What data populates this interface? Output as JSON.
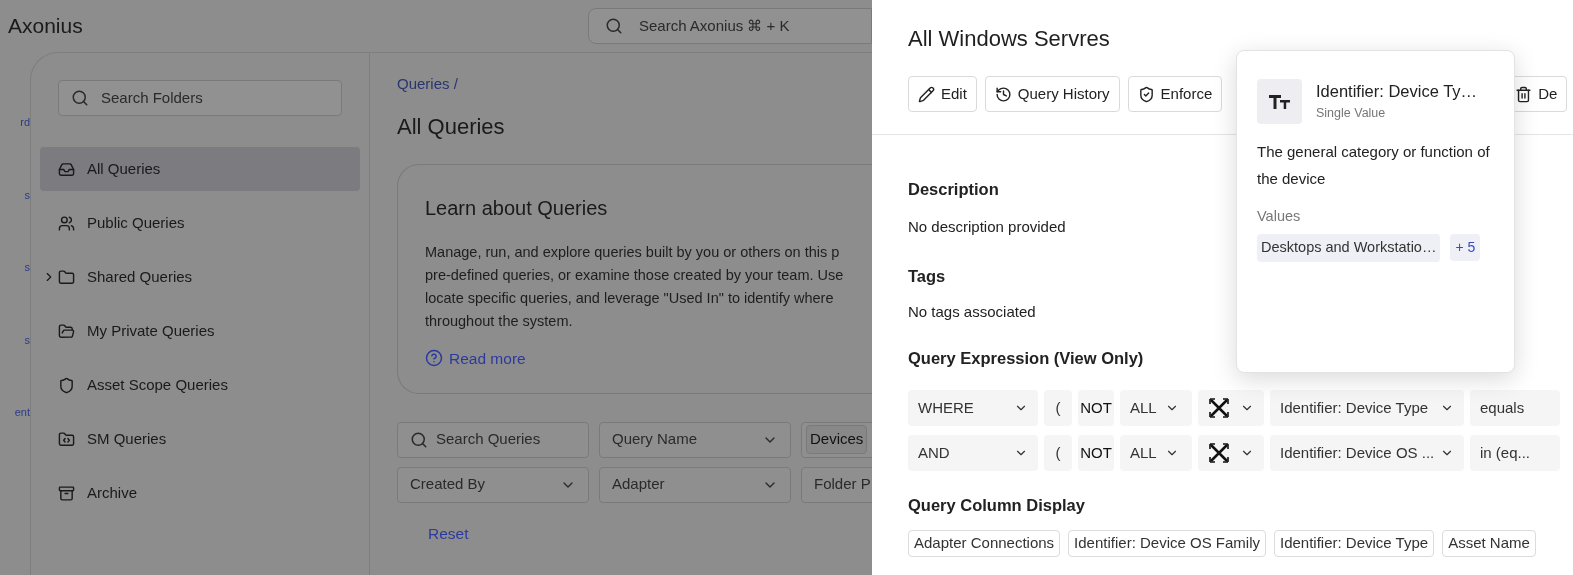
{
  "app": {
    "logo": "Axonius",
    "search_placeholder": "Search Axonius ⌘ + K"
  },
  "nav_fragments": [
    "rd",
    "s",
    "s",
    "s",
    "ent"
  ],
  "folders": {
    "search_placeholder": "Search Folders",
    "items": [
      {
        "label": "All Queries",
        "selected": true,
        "expandable": false
      },
      {
        "label": "Public Queries",
        "selected": false,
        "expandable": false
      },
      {
        "label": "Shared Queries",
        "selected": false,
        "expandable": true
      },
      {
        "label": "My Private Queries",
        "selected": false,
        "expandable": false
      },
      {
        "label": "Asset Scope Queries",
        "selected": false,
        "expandable": false
      },
      {
        "label": "SM Queries",
        "selected": false,
        "expandable": false
      },
      {
        "label": "Archive",
        "selected": false,
        "expandable": false
      }
    ]
  },
  "content": {
    "breadcrumb": "Queries /",
    "title": "All Queries",
    "learn_card": {
      "title": "Learn about Queries",
      "lines": [
        "Manage, run, and explore queries built by you or others on this p",
        "pre-defined queries, or examine those created by your team. Use",
        "locate specific queries, and leverage \"Used In\" to identify where",
        "throughout the system."
      ],
      "link": "Read more"
    },
    "filters": [
      {
        "kind": "search",
        "placeholder": "Search Queries"
      },
      {
        "kind": "select",
        "label": "Query Name"
      },
      {
        "kind": "chip",
        "label": "Devices"
      },
      {
        "kind": "select",
        "label": "Created By"
      },
      {
        "kind": "select",
        "label": "Adapter"
      },
      {
        "kind": "plain",
        "label": "Folder P"
      }
    ],
    "reset": "Reset"
  },
  "drawer": {
    "title": "All Windows Servres",
    "actions": [
      "Edit",
      "Query History",
      "Enforce",
      "De"
    ],
    "description_heading": "Description",
    "description": "No description provided",
    "tags_heading": "Tags",
    "tags": "No tags associated",
    "expression_heading": "Query Expression (View Only)",
    "expression_rows": [
      {
        "connector": "WHERE",
        "paren": "(",
        "not": "NOT",
        "scope": "ALL",
        "field": "Identifier: Device Type",
        "operator": "equals"
      },
      {
        "connector": "AND",
        "paren": "(",
        "not": "NOT",
        "scope": "ALL",
        "field": "Identifier: Device OS ...",
        "operator": "in (eq..."
      }
    ],
    "columns_heading": "Query Column Display",
    "columns": [
      "Adapter Connections",
      "Identifier: Device OS Family",
      "Identifier: Device Type",
      "Asset Name"
    ]
  },
  "popover": {
    "title": "Identifier: Device Ty…",
    "subtitle": "Single Value",
    "description": "The general category or function of the device",
    "values_label": "Values",
    "values": [
      "Desktops and Workstatio…"
    ],
    "more": "+ 5"
  }
}
